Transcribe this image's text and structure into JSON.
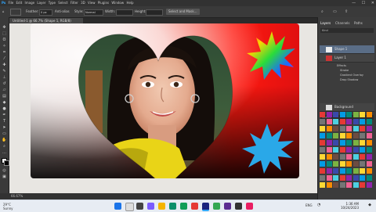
{
  "menubar": {
    "items": [
      "Ps",
      "File",
      "Edit",
      "Image",
      "Layer",
      "Type",
      "Select",
      "Filter",
      "3D",
      "View",
      "Plugins",
      "Window",
      "Help"
    ]
  },
  "window_controls": [
    "—",
    "☐",
    "✕"
  ],
  "options": {
    "feather_label": "Feather:",
    "feather_value": "0 px",
    "antialias_label": "Anti-alias",
    "style_label": "Style:",
    "style_value": "Normal",
    "width_label": "Width:",
    "height_label": "Height:",
    "mask_button": "Select and Mask..."
  },
  "document_tab": "Untitled-1 @ 66.7% (Shape 1, RGB/8)",
  "status": "66.67%",
  "panels": {
    "tabs": [
      "Layers",
      "Channels",
      "Paths"
    ],
    "filter_label": "Kind"
  },
  "layers": [
    {
      "name": "Shape 1"
    },
    {
      "name": "Layer 1"
    },
    {
      "name": "Effects"
    },
    {
      "name": "Stroke"
    },
    {
      "name": "Gradient Overlay"
    },
    {
      "name": "Drop Shadow"
    },
    {
      "name": "Background"
    }
  ],
  "layer_search": "Search",
  "taskbar": {
    "weather_temp": "29°C",
    "weather_desc": "Sunny",
    "time": "1:36 AM",
    "date": "10/24/2023",
    "lang": "ENG"
  },
  "colors": {
    "canvas_red": "#ff1a10",
    "accent": "#1473e6",
    "swatch_set": [
      "#e53935",
      "#8e24aa",
      "#3949ab",
      "#039be5",
      "#00897b",
      "#7cb342",
      "#fdd835",
      "#fb8c00",
      "#6d4c41",
      "#757575",
      "#f06292",
      "#4dd0e1"
    ]
  },
  "icons": [
    "move-icon",
    "marquee-icon",
    "lasso-icon",
    "crop-icon",
    "eyedropper-icon",
    "brush-icon",
    "stamp-icon",
    "eraser-icon",
    "gradient-icon",
    "blur-icon",
    "pen-icon",
    "type-icon",
    "path-select-icon",
    "shape-icon",
    "hand-icon",
    "zoom-icon"
  ]
}
